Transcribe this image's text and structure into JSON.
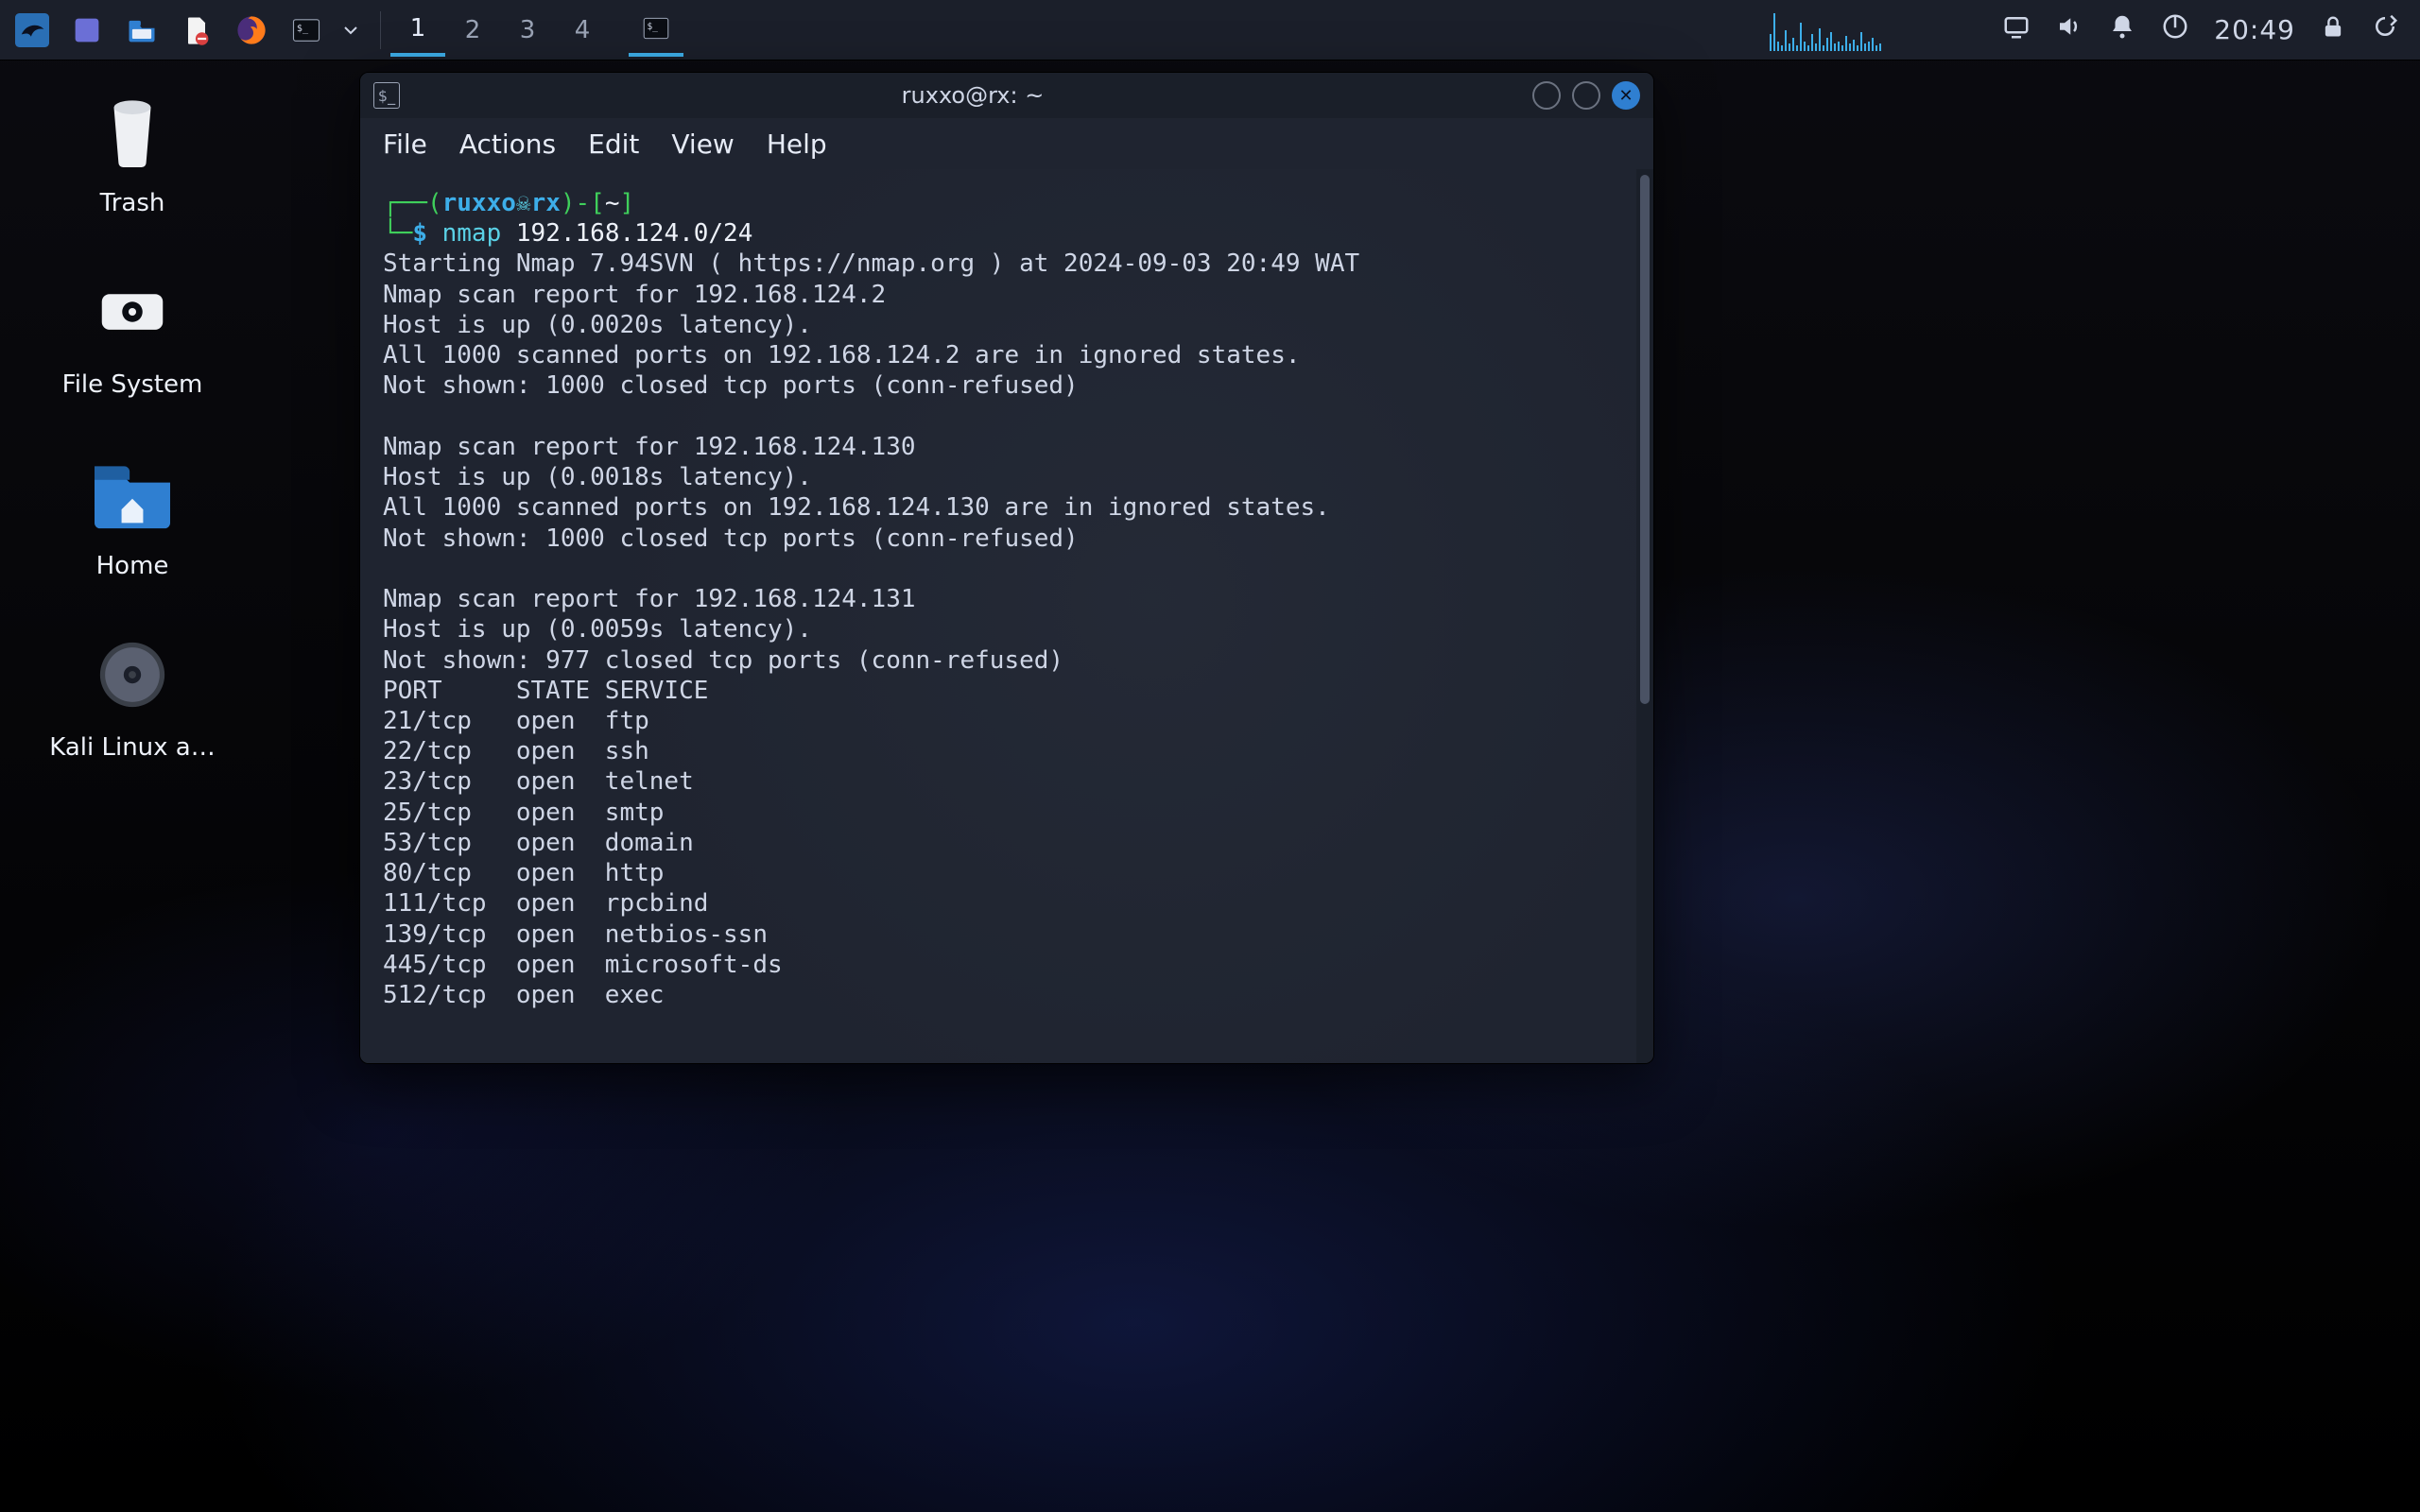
{
  "panel": {
    "workspaces": [
      "1",
      "2",
      "3",
      "4"
    ],
    "active_workspace": 0,
    "clock": "20:49"
  },
  "desktop_icons": [
    {
      "id": "trash",
      "label": "Trash"
    },
    {
      "id": "filesystem",
      "label": "File System"
    },
    {
      "id": "home",
      "label": "Home"
    },
    {
      "id": "kali-iso",
      "label": "Kali Linux a…"
    }
  ],
  "terminal": {
    "title": "ruxxo@rx: ~",
    "menus": [
      "File",
      "Actions",
      "Edit",
      "View",
      "Help"
    ],
    "prompt": {
      "user": "ruxxo",
      "host": "rx",
      "skull": "☠",
      "cwd": "~",
      "symbol": "$",
      "command_name": "nmap",
      "command_args": "192.168.124.0/24"
    },
    "output": [
      "Starting Nmap 7.94SVN ( https://nmap.org ) at 2024-09-03 20:49 WAT",
      "Nmap scan report for 192.168.124.2",
      "Host is up (0.0020s latency).",
      "All 1000 scanned ports on 192.168.124.2 are in ignored states.",
      "Not shown: 1000 closed tcp ports (conn-refused)",
      "",
      "Nmap scan report for 192.168.124.130",
      "Host is up (0.0018s latency).",
      "All 1000 scanned ports on 192.168.124.130 are in ignored states.",
      "Not shown: 1000 closed tcp ports (conn-refused)",
      "",
      "Nmap scan report for 192.168.124.131",
      "Host is up (0.0059s latency).",
      "Not shown: 977 closed tcp ports (conn-refused)",
      "PORT     STATE SERVICE",
      "21/tcp   open  ftp",
      "22/tcp   open  ssh",
      "23/tcp   open  telnet",
      "25/tcp   open  smtp",
      "53/tcp   open  domain",
      "80/tcp   open  http",
      "111/tcp  open  rpcbind",
      "139/tcp  open  netbios-ssn",
      "445/tcp  open  microsoft-ds",
      "512/tcp  open  exec"
    ]
  }
}
